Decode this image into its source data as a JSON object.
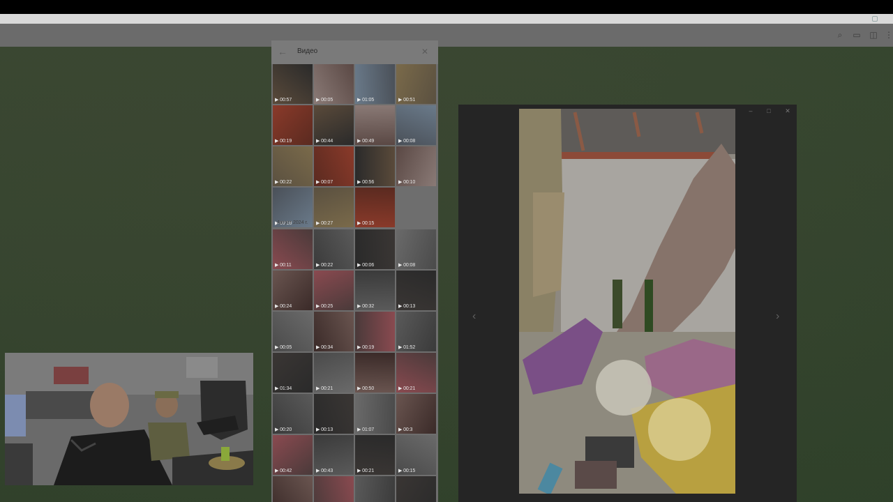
{
  "header_icons": [
    "search-icon",
    "comments-icon",
    "sidebar-toggle-icon",
    "more-vertical-icon"
  ],
  "video_panel": {
    "title": "Видео",
    "back_icon": "arrow-left-icon",
    "close_icon": "close-icon",
    "recent_videos": [
      "00:57",
      "00:05",
      "01:05",
      "00:51",
      "00:19",
      "00:44",
      "00:49",
      "00:08",
      "00:22",
      "00:07",
      "00:56",
      "00:10",
      "00:18",
      "00:27",
      "00:15"
    ],
    "month_label": "Август 2024 г.",
    "august_videos": [
      "00:11",
      "00:22",
      "00:06",
      "00:08",
      "00:24",
      "00:25",
      "00:32",
      "00:13",
      "00:05",
      "00:34",
      "00:19",
      "01:52",
      "01:34",
      "00:21",
      "00:50",
      "00:21",
      "00:20",
      "00:13",
      "01:07",
      "00:3",
      "00:42",
      "00:43",
      "00:21",
      "00:15",
      "",
      "",
      "",
      ""
    ]
  },
  "viewer": {
    "minimize_icon": "minimize-icon",
    "maximize_icon": "maximize-icon",
    "close_icon": "close-icon",
    "prev_icon": "chevron-left-icon",
    "next_icon": "chevron-right-icon"
  },
  "colors": {
    "chat_background": "#3d4a34",
    "panel": "#6e6e6e",
    "viewer": "#252525"
  }
}
